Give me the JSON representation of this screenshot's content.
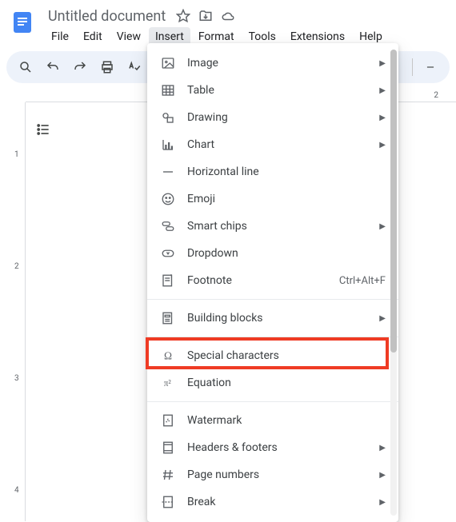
{
  "doc": {
    "title": "Untitled document"
  },
  "menubar": [
    "File",
    "Edit",
    "View",
    "Insert",
    "Format",
    "Tools",
    "Extensions",
    "Help"
  ],
  "menubar_active": "Insert",
  "ruler_h_label": "2",
  "ruler_v_labels": [
    "1",
    "2",
    "3",
    "4"
  ],
  "menu": {
    "groups": [
      [
        {
          "id": "image",
          "label": "Image",
          "icon": "image-icon",
          "submenu": true
        },
        {
          "id": "table",
          "label": "Table",
          "icon": "table-icon",
          "submenu": true
        },
        {
          "id": "drawing",
          "label": "Drawing",
          "icon": "drawing-icon",
          "submenu": true
        },
        {
          "id": "chart",
          "label": "Chart",
          "icon": "chart-icon",
          "submenu": true
        },
        {
          "id": "hr",
          "label": "Horizontal line",
          "icon": "minus-icon"
        },
        {
          "id": "emoji",
          "label": "Emoji",
          "icon": "emoji-icon"
        },
        {
          "id": "smartchips",
          "label": "Smart chips",
          "icon": "chips-icon",
          "submenu": true
        },
        {
          "id": "dropdown",
          "label": "Dropdown",
          "icon": "dropdown-icon"
        },
        {
          "id": "footnote",
          "label": "Footnote",
          "icon": "footnote-icon",
          "shortcut": "Ctrl+Alt+F"
        }
      ],
      [
        {
          "id": "buildingblocks",
          "label": "Building blocks",
          "icon": "blocks-icon",
          "submenu": true
        }
      ],
      [
        {
          "id": "specialchars",
          "label": "Special characters",
          "icon": "omega-icon",
          "highlighted": true
        },
        {
          "id": "equation",
          "label": "Equation",
          "icon": "pi-icon"
        }
      ],
      [
        {
          "id": "watermark",
          "label": "Watermark",
          "icon": "watermark-icon"
        },
        {
          "id": "headersfooters",
          "label": "Headers & footers",
          "icon": "headerfooter-icon",
          "submenu": true
        },
        {
          "id": "pagenumbers",
          "label": "Page numbers",
          "icon": "hash-icon",
          "submenu": true
        },
        {
          "id": "break",
          "label": "Break",
          "icon": "break-icon",
          "submenu": true
        }
      ]
    ]
  }
}
